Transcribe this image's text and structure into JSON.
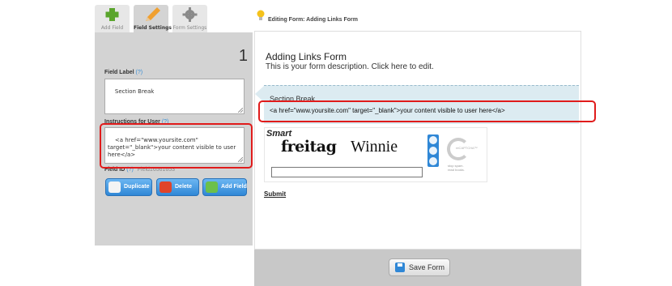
{
  "tabs": [
    {
      "label": "Add Field",
      "icon": "plus-icon",
      "active": false
    },
    {
      "label": "Field Settings",
      "icon": "pencil-icon",
      "active": true
    },
    {
      "label": "Form Settings",
      "icon": "gear-icon",
      "active": false
    }
  ],
  "field_settings": {
    "field_number": "1",
    "field_label_title": "Field Label",
    "help_marker": "(?)",
    "field_label_value": "Section Break",
    "instructions_title": "Instructions for User",
    "instructions_value": "<a href=\"www.yoursite.com\"\ntarget=\"_blank\">your content visible to user\nhere</a>",
    "field_id_title": "Field ID",
    "field_id_value": "Field16561653",
    "buttons": {
      "duplicate": "Duplicate",
      "delete": "Delete",
      "add_field": "Add Field"
    }
  },
  "breadcrumb": "Editing Form: Adding Links Form",
  "form": {
    "title": "Adding Links Form",
    "description": "This is your form description. Click here to edit.",
    "section_title": "Section Break",
    "section_instructions": "<a href=\"www.yoursite.com\" target=\"_blank\">your content visible to user here</a>",
    "captcha": {
      "brand": "Smart",
      "word1": "freitag",
      "word2": "Winnie",
      "logo_text": "reCAPTCHA™",
      "tagline": "stop spam.\nread books."
    },
    "submit_label": "Submit"
  },
  "save_label": "Save Form",
  "colors": {
    "accent": "#2f87d6",
    "highlight": "#e01b1b",
    "panel": "#d3d3d3",
    "section_bg": "#dcebf1"
  }
}
